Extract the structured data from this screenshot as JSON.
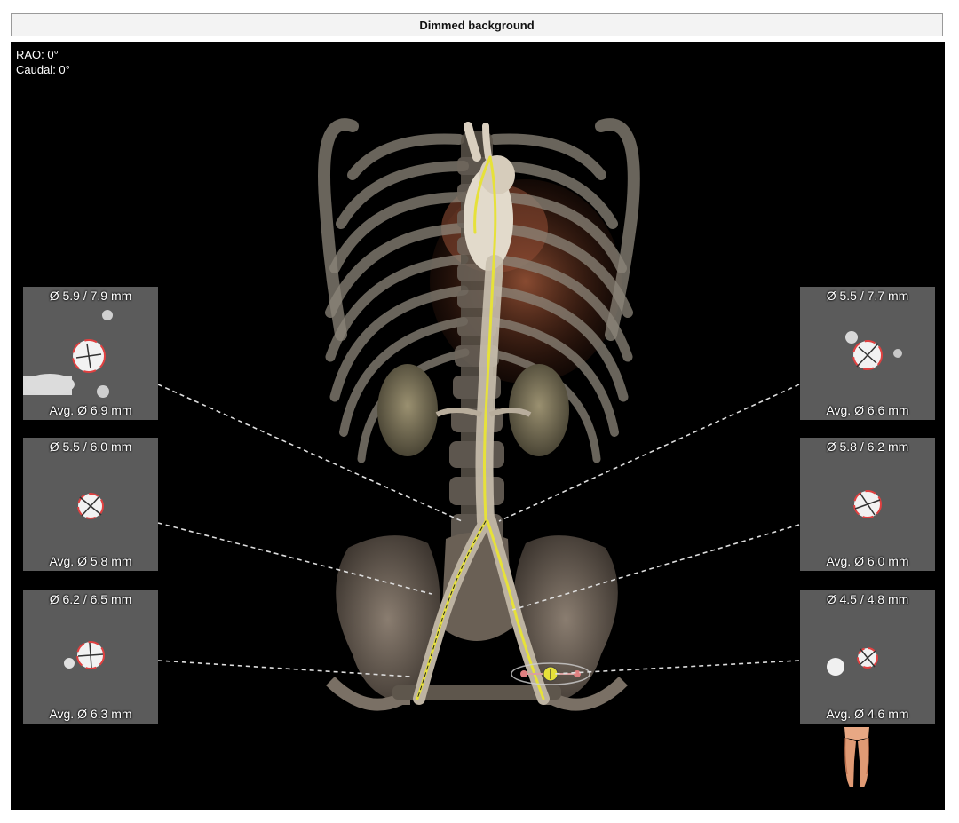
{
  "title": "Dimmed background",
  "orientation": {
    "rao": "RAO: 0°",
    "caudal": "Caudal: 0°"
  },
  "icons": {
    "centerline": "vessel-centerline",
    "body": "body-orientation-legs-icon"
  },
  "colors": {
    "centerline": "#e6e13a",
    "marker": "#e04040",
    "leader": "#dddddd"
  },
  "panels_left": [
    {
      "diameter": "Ø 5.9 / 7.9 mm",
      "average": "Avg. Ø 6.9 mm"
    },
    {
      "diameter": "Ø 5.5 / 6.0 mm",
      "average": "Avg. Ø 5.8 mm"
    },
    {
      "diameter": "Ø 6.2 / 6.5 mm",
      "average": "Avg. Ø 6.3 mm"
    }
  ],
  "panels_right": [
    {
      "diameter": "Ø 5.5 / 7.7 mm",
      "average": "Avg. Ø 6.6 mm"
    },
    {
      "diameter": "Ø 5.8 / 6.2 mm",
      "average": "Avg. Ø 6.0 mm"
    },
    {
      "diameter": "Ø 4.5 / 4.8 mm",
      "average": "Avg. Ø 4.6 mm"
    }
  ]
}
